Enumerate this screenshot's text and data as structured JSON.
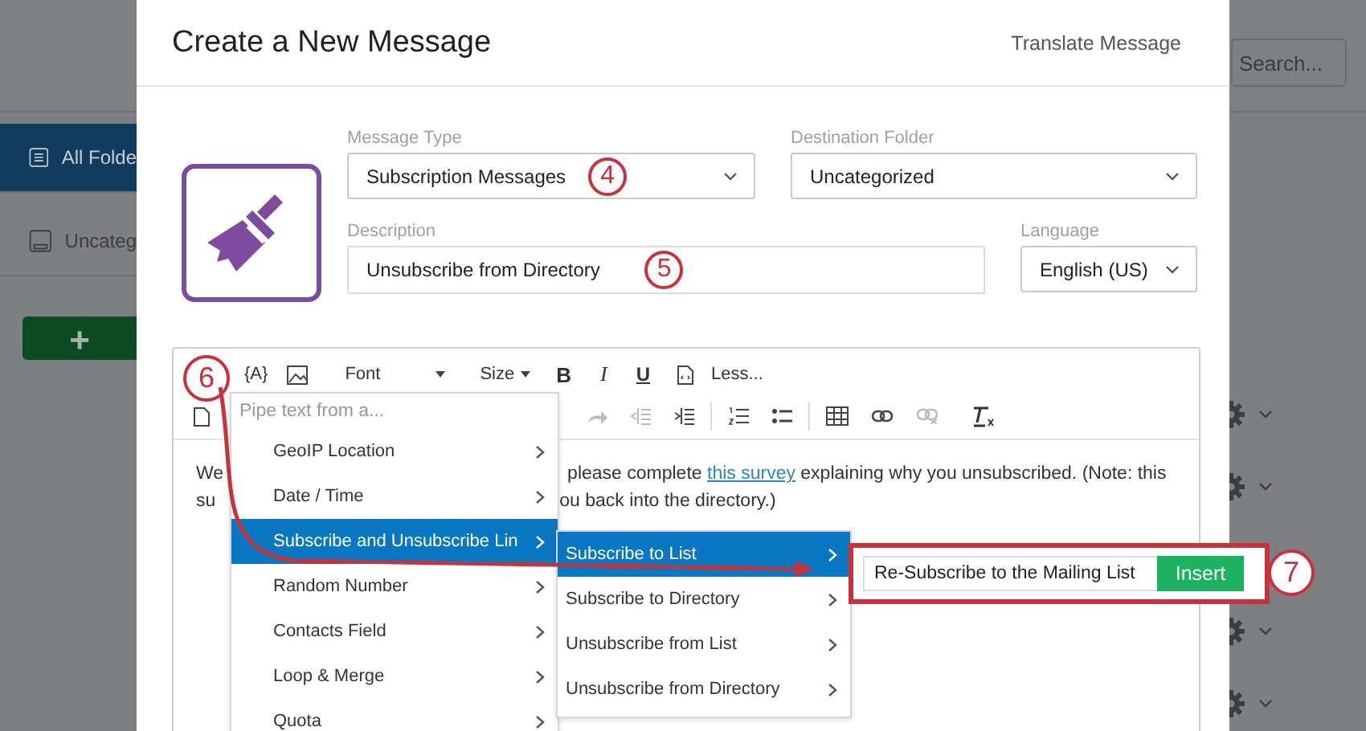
{
  "app": {
    "sidebar": {
      "items": [
        {
          "label": "All Folde",
          "selected": true
        },
        {
          "label": "Uncateg",
          "selected": false
        }
      ],
      "add_button": "+"
    },
    "search": {
      "placeholder": "Search..."
    }
  },
  "dialog": {
    "title": "Create a New Message",
    "translate_link": "Translate Message",
    "message_type": {
      "label": "Message Type",
      "value": "Subscription Messages"
    },
    "destination_folder": {
      "label": "Destination Folder",
      "value": "Uncategorized"
    },
    "description": {
      "label": "Description",
      "value": "Unsubscribe from Directory"
    },
    "language": {
      "label": "Language",
      "value": "English (US)"
    },
    "editor": {
      "toolbar": {
        "piped_text": "{A}",
        "font": "Font",
        "size": "Size",
        "bold": "B",
        "italic": "I",
        "underline": "U",
        "less": "Less..."
      },
      "body": [
        {
          "start": "We",
          "before": "please complete ",
          "link": "this survey",
          "after": " explaining why you unsubscribed. (Note: this"
        },
        {
          "start": "su",
          "before": "ou back into the directory.)"
        }
      ],
      "pipe_menu": {
        "header": "Pipe text from a...",
        "items": [
          {
            "label": "GeoIP Location",
            "selected": false
          },
          {
            "label": "Date / Time",
            "selected": false
          },
          {
            "label": "Subscribe and Unsubscribe Lin",
            "selected": true
          },
          {
            "label": "Random Number",
            "selected": false
          },
          {
            "label": "Contacts Field",
            "selected": false
          },
          {
            "label": "Loop & Merge",
            "selected": false
          },
          {
            "label": "Quota",
            "selected": false
          }
        ]
      },
      "submenu": {
        "items": [
          {
            "label": "Subscribe to List",
            "selected": true
          },
          {
            "label": "Subscribe to Directory",
            "selected": false
          },
          {
            "label": "Unsubscribe from List",
            "selected": false
          },
          {
            "label": "Unsubscribe from Directory",
            "selected": false
          }
        ]
      },
      "insert_panel": {
        "value": "Re-Subscribe to the Mailing List",
        "button": "Insert"
      }
    }
  },
  "annotations": [
    "4",
    "5",
    "6",
    "7"
  ]
}
